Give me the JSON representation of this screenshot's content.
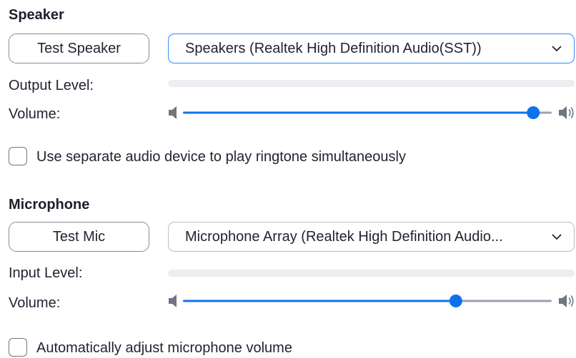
{
  "speaker": {
    "title": "Speaker",
    "test_button": "Test Speaker",
    "device": "Speakers (Realtek High Definition Audio(SST))",
    "output_level_label": "Output Level:",
    "output_level": 0,
    "volume_label": "Volume:",
    "volume": 0.95,
    "ringtone_checkbox_label": "Use separate audio device to play ringtone simultaneously",
    "ringtone_checked": false
  },
  "microphone": {
    "title": "Microphone",
    "test_button": "Test Mic",
    "device": "Microphone Array (Realtek High Definition Audio...",
    "input_level_label": "Input Level:",
    "input_level": 0,
    "volume_label": "Volume:",
    "volume": 0.74,
    "auto_adjust_label": "Automatically adjust microphone volume",
    "auto_adjust_checked": false
  },
  "colors": {
    "accent": "#0e72ed",
    "track_inactive": "#9e9eb4",
    "speaker_icon": "#6e7680",
    "focus_border": "#2d8cff"
  },
  "icons": {
    "volume_low": "speaker-low-icon",
    "volume_high": "speaker-high-icon",
    "dropdown": "chevron-down-icon"
  }
}
